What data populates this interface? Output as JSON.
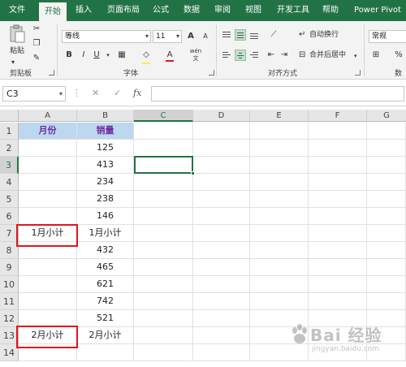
{
  "tabs": [
    "文件",
    "开始",
    "插入",
    "页面布局",
    "公式",
    "数据",
    "审阅",
    "视图",
    "开发工具",
    "帮助",
    "Power Pivot"
  ],
  "active_tab": "开始",
  "ribbon": {
    "clipboard": {
      "paste_label": "粘贴",
      "group_label": "剪贴板"
    },
    "font": {
      "font_name": "等线",
      "font_size": "11",
      "grow_label": "A",
      "shrink_label": "A",
      "bold": "B",
      "italic": "I",
      "underline": "U",
      "wen_label": "wén",
      "group_label": "字体"
    },
    "alignment": {
      "wrap_label": "自动换行",
      "merge_label": "合并后居中",
      "group_label": "对齐方式"
    },
    "number": {
      "format": "常规",
      "percent": "%",
      "group_label": "数"
    }
  },
  "formula_bar": {
    "name_box": "C3",
    "fx_label": "fx",
    "cancel_glyph": "✕",
    "enter_glyph": "✓",
    "value": ""
  },
  "columns": [
    "A",
    "B",
    "C",
    "D",
    "E",
    "F",
    "G"
  ],
  "rows": [
    {
      "num": "1",
      "a": "月份",
      "b": "销量"
    },
    {
      "num": "2",
      "a": "",
      "b": "125"
    },
    {
      "num": "3",
      "a": "",
      "b": "413"
    },
    {
      "num": "4",
      "a": "",
      "b": "234"
    },
    {
      "num": "5",
      "a": "",
      "b": "238"
    },
    {
      "num": "6",
      "a": "",
      "b": "146"
    },
    {
      "num": "7",
      "a": "1月小计",
      "b": "1月小计"
    },
    {
      "num": "8",
      "a": "",
      "b": "432"
    },
    {
      "num": "9",
      "a": "",
      "b": "465"
    },
    {
      "num": "10",
      "a": "",
      "b": "621"
    },
    {
      "num": "11",
      "a": "",
      "b": "742"
    },
    {
      "num": "12",
      "a": "",
      "b": "521"
    },
    {
      "num": "13",
      "a": "2月小计",
      "b": "2月小计"
    },
    {
      "num": "14",
      "a": "",
      "b": ""
    }
  ],
  "selected_cell": "C3",
  "header_fill_color": "#bdd7ee",
  "header_text_color": "#7030a0",
  "accent_color": "#217346",
  "highlight_color": "#e0161c",
  "watermark": {
    "main": "Bai 经验",
    "sub": "jingyan.baidu.com"
  }
}
